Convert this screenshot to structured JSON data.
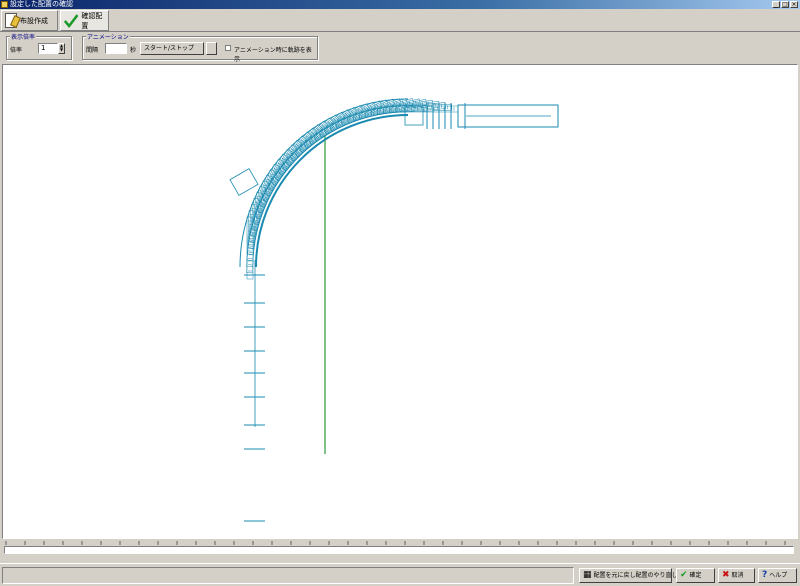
{
  "window": {
    "title": "設定した配置の確認",
    "controls": [
      "_",
      "□",
      "×"
    ]
  },
  "tabs": [
    {
      "label": "布設作成",
      "icon": "document-pen-icon",
      "active": false
    },
    {
      "label": "確認配置",
      "icon": "green-check-icon",
      "active": true
    }
  ],
  "toolbar": {
    "zoom_group": {
      "title": "表示倍率",
      "label": "倍率",
      "value": "1"
    },
    "animation_group": {
      "title": "アニメーション",
      "interval_label": "間隔",
      "interval_value": "",
      "interval_unit": "秒",
      "start_button": "スタート/ストップ",
      "checkbox_label": "アニメーション時に軌跡を表示"
    }
  },
  "footer": {
    "layout_button": "配置を元に戻し配置のやり直し",
    "ok_button": "確定",
    "cancel_button": "取消",
    "help_button": "ヘルプ"
  },
  "colors": {
    "track": "#1a8ab0",
    "centerline": "#2a9a3a",
    "active_tab": "#e8e6e0",
    "title_gradient_start": "#0a246a"
  }
}
